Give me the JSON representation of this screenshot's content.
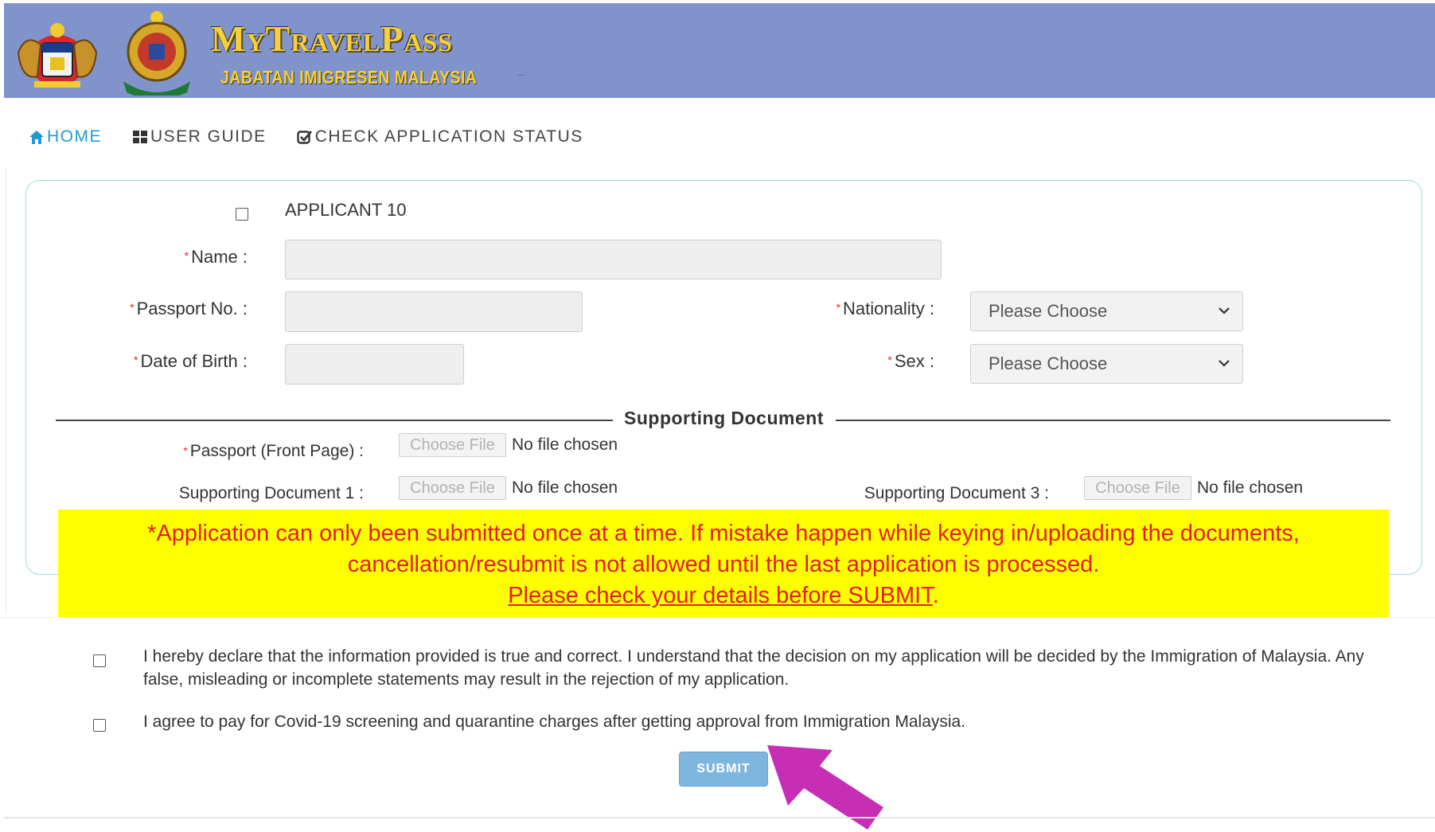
{
  "header": {
    "title": "MyTravelPass",
    "subtitle": "JABATAN IMIGRESEN MALAYSIA"
  },
  "nav": {
    "home": "HOME",
    "user_guide": "USER GUIDE",
    "check_status": "CHECK APPLICATION STATUS"
  },
  "form": {
    "applicant_label": "APPLICANT 10",
    "name_label": "Name :",
    "passport_label": "Passport No. :",
    "nationality_label": "Nationality :",
    "nationality_value": "Please Choose",
    "dob_label": "Date of Birth :",
    "sex_label": "Sex :",
    "sex_value": "Please Choose",
    "required_mark": "*"
  },
  "supporting": {
    "section_title": "Supporting Document",
    "passport_front_label": "Passport (Front Page) :",
    "doc1_label": "Supporting Document 1 :",
    "doc3_label": "Supporting Document 3 :",
    "choose_file": "Choose File",
    "no_file": "No file chosen"
  },
  "notice": {
    "line1": "*Application can only been submitted once at a time. If mistake happen while keying in/uploading the documents,",
    "line2": "cancellation/resubmit is not allowed until the last application is processed.",
    "line3": "Please check your details before SUBMIT",
    "line3_end": "."
  },
  "declarations": {
    "declare_text": "I hereby declare that the information provided is true and correct. I understand that the decision on my application will be decided by the Immigration of Malaysia. Any false, misleading or incomplete statements may result in the rejection of my application.",
    "agree_text": "I agree to pay for Covid-19 screening and quarantine charges after getting approval from Immigration Malaysia."
  },
  "submit_label": "SUBMIT",
  "colors": {
    "header_bg": "#8094cb",
    "brand_gold": "#f5d03a",
    "nav_active": "#1f9bd1",
    "panel_border": "#9fd9e3",
    "notice_bg": "#ffff00",
    "notice_text": "#e31e24",
    "submit_bg": "#7fb6e0",
    "arrow": "#c62fb4"
  }
}
